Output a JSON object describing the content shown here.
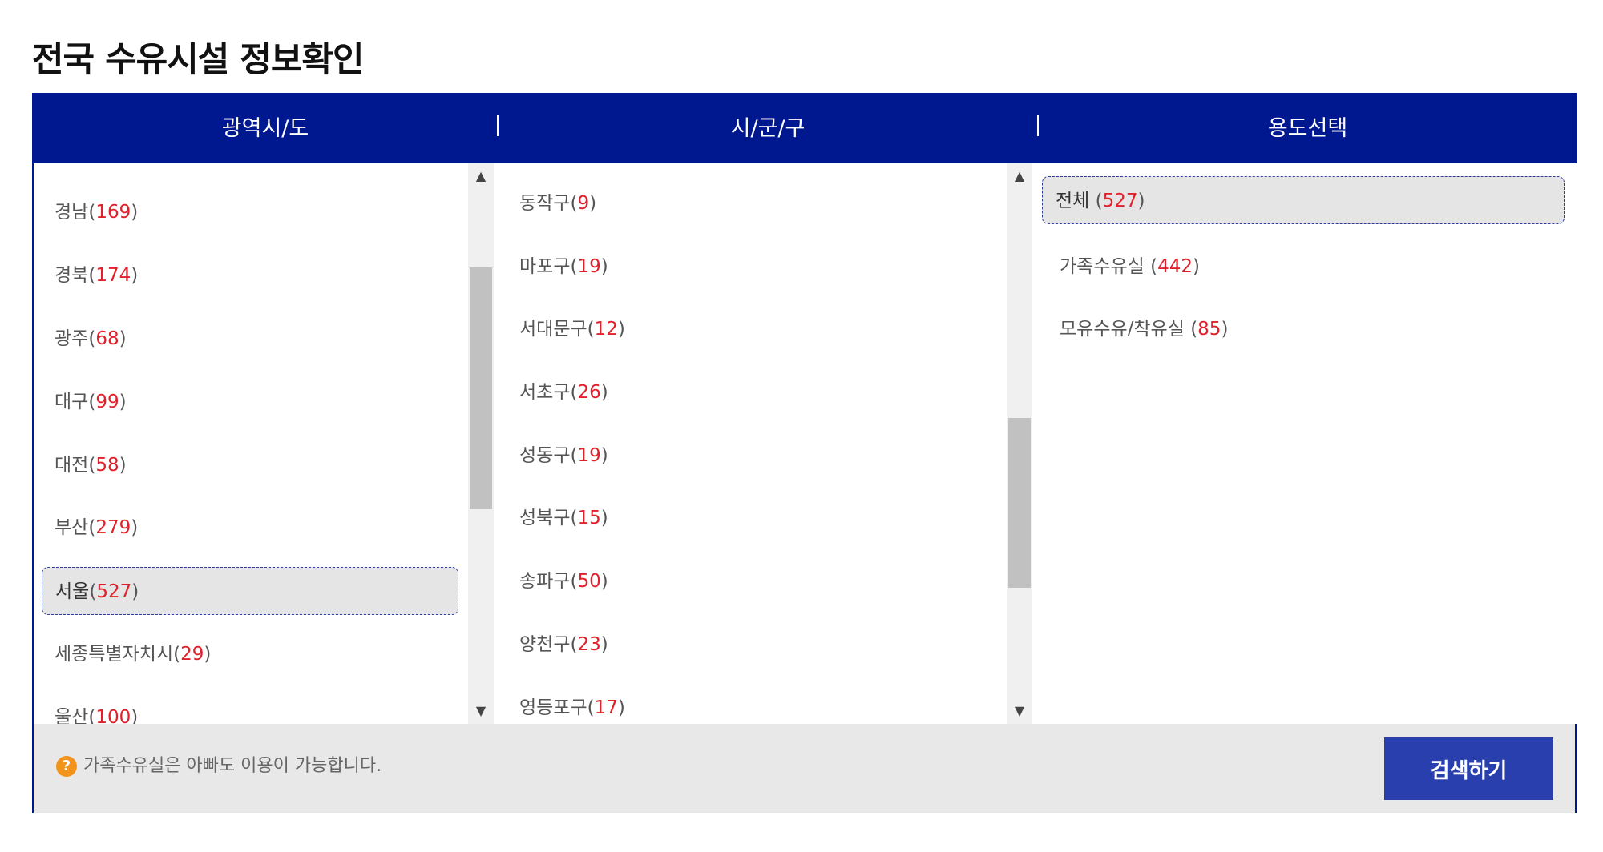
{
  "page": {
    "title": "전국 수유시설 정보확인"
  },
  "columns": {
    "region": "광역시/도",
    "district": "시/군/구",
    "usage": "용도선택"
  },
  "regions": [
    {
      "name": "경남",
      "count": "169",
      "selected": false
    },
    {
      "name": "경북",
      "count": "174",
      "selected": false
    },
    {
      "name": "광주",
      "count": "68",
      "selected": false
    },
    {
      "name": "대구",
      "count": "99",
      "selected": false
    },
    {
      "name": "대전",
      "count": "58",
      "selected": false
    },
    {
      "name": "부산",
      "count": "279",
      "selected": false
    },
    {
      "name": "서울",
      "count": "527",
      "selected": true
    },
    {
      "name": "세종특별자치시",
      "count": "29",
      "selected": false
    },
    {
      "name": "울산",
      "count": "100",
      "selected": false
    }
  ],
  "districts": [
    {
      "name": "동작구",
      "count": "9"
    },
    {
      "name": "마포구",
      "count": "19"
    },
    {
      "name": "서대문구",
      "count": "12"
    },
    {
      "name": "서초구",
      "count": "26"
    },
    {
      "name": "성동구",
      "count": "19"
    },
    {
      "name": "성북구",
      "count": "15"
    },
    {
      "name": "송파구",
      "count": "50"
    },
    {
      "name": "양천구",
      "count": "23"
    },
    {
      "name": "영등포구",
      "count": "17"
    }
  ],
  "usages": [
    {
      "name": "전체 ",
      "count": "527",
      "selected": true
    },
    {
      "name": "가족수유실 ",
      "count": "442",
      "selected": false
    },
    {
      "name": "모유수유/착유실 ",
      "count": "85",
      "selected": false
    }
  ],
  "footer": {
    "help_icon": "?",
    "help_text": "가족수유실은 아빠도 이용이 가능합니다.",
    "search_label": "검색하기"
  },
  "icons": {
    "scroll_up": "▲",
    "scroll_down": "▼"
  },
  "colors": {
    "header_bg": "#00188f",
    "button_bg": "#2a3fae",
    "count_text": "#e0202a",
    "help_icon": "#f2941b"
  }
}
